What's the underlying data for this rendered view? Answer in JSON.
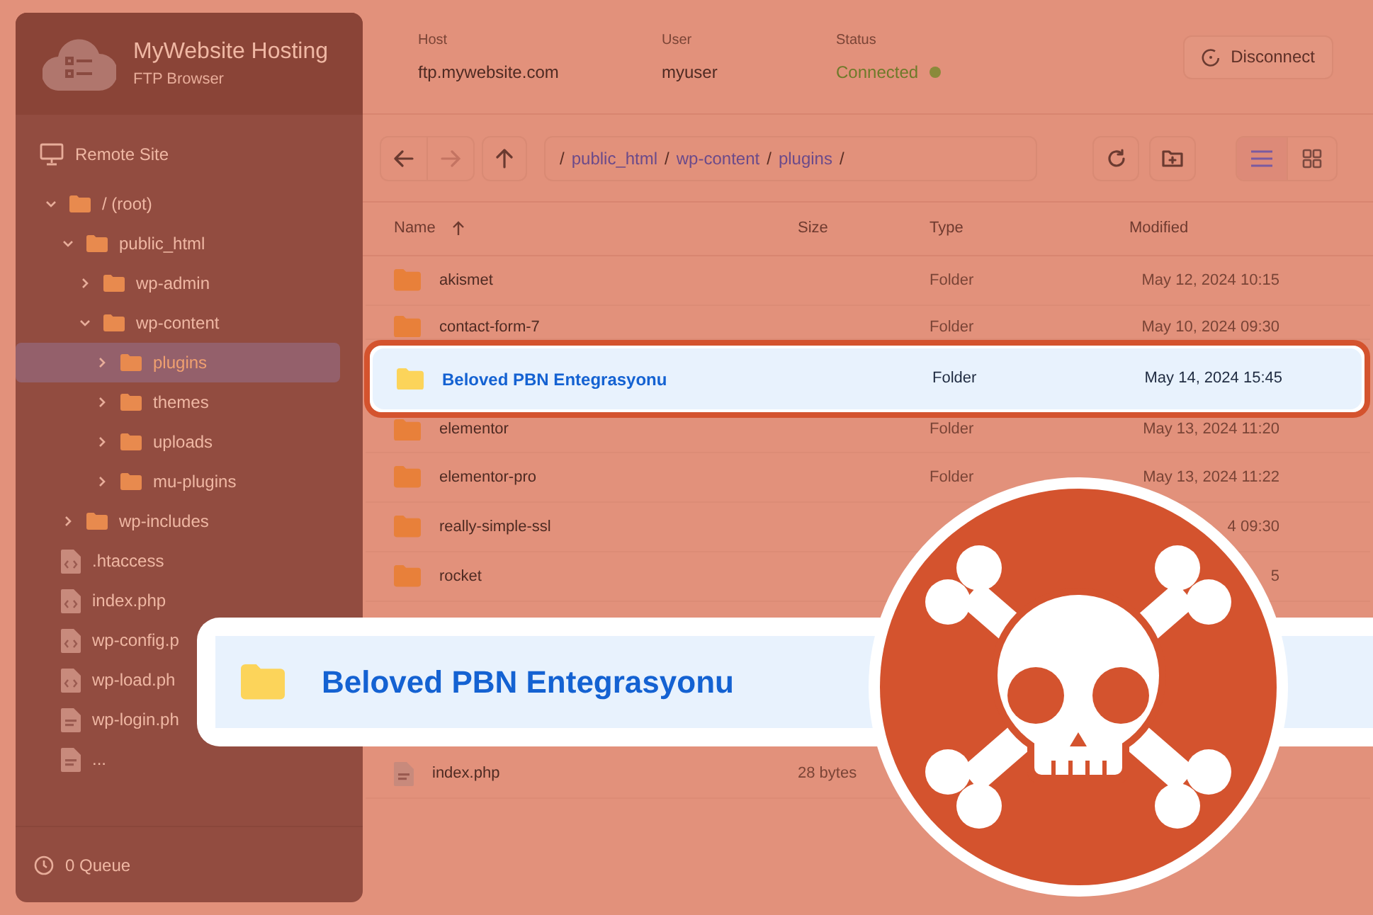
{
  "sidebar": {
    "title": "MyWebsite Hosting",
    "subtitle": "FTP Browser",
    "section": "Remote Site",
    "tree": [
      {
        "name": "/ (root)",
        "kind": "folder",
        "expanded": true,
        "selected": false,
        "children": [
          {
            "name": "public_html",
            "kind": "folder",
            "expanded": true,
            "selected": false,
            "children": [
              {
                "name": "wp-admin",
                "kind": "folder",
                "expanded": false,
                "selected": false
              },
              {
                "name": "wp-content",
                "kind": "folder",
                "expanded": true,
                "selected": false,
                "children": [
                  {
                    "name": "plugins",
                    "kind": "folder",
                    "expanded": false,
                    "selected": true
                  },
                  {
                    "name": "themes",
                    "kind": "folder",
                    "expanded": false,
                    "selected": false
                  },
                  {
                    "name": "uploads",
                    "kind": "folder",
                    "expanded": false,
                    "selected": false
                  },
                  {
                    "name": "mu-plugins",
                    "kind": "folder",
                    "expanded": false,
                    "selected": false
                  }
                ]
              }
            ]
          },
          {
            "name": "wp-includes",
            "kind": "folder",
            "expanded": false,
            "selected": false
          },
          {
            "name": ".htaccess",
            "kind": "code",
            "selected": false
          },
          {
            "name": "index.php",
            "kind": "code",
            "selected": false
          },
          {
            "name": "wp-config.p",
            "kind": "code",
            "selected": false
          },
          {
            "name": "wp-load.ph",
            "kind": "code",
            "selected": false
          },
          {
            "name": "wp-login.ph",
            "kind": "php",
            "selected": false
          },
          {
            "name": "...",
            "kind": "php",
            "selected": false
          }
        ]
      }
    ],
    "queue": "0 Queue"
  },
  "connection": [
    {
      "label": "Host",
      "value": "ftp.mywebsite.com",
      "kind": "text"
    },
    {
      "label": "User",
      "value": "myuser",
      "kind": "text"
    },
    {
      "label": "Status",
      "value": "Connected",
      "kind": "status"
    }
  ],
  "disconnect": "Disconnect",
  "path": [
    {
      "text": "/",
      "kind": "separator"
    },
    {
      "text": "public_html",
      "kind": "link"
    },
    {
      "text": "/",
      "kind": "separator"
    },
    {
      "text": "wp-content",
      "kind": "link"
    },
    {
      "text": "/",
      "kind": "separator"
    },
    {
      "text": "plugins",
      "kind": "link"
    },
    {
      "text": "/",
      "kind": "separator"
    }
  ],
  "views": [
    {
      "kind": "list",
      "selected": true
    },
    {
      "kind": "grid",
      "selected": false
    }
  ],
  "table": {
    "columns": [
      "Name",
      "Size",
      "Type",
      "Modified"
    ],
    "rows": [
      {
        "name": "akismet",
        "kind": "folder",
        "type": "Folder",
        "modified": "May 12, 2024 10:15",
        "selected": false
      },
      {
        "name": "contact-form-7",
        "kind": "folder",
        "type": "Folder",
        "modified": "May 10, 2024 09:30",
        "selected": false
      },
      {
        "name": "Beloved PBN Entegrasyonu",
        "kind": "folder",
        "type": "Folder",
        "modified": "May 14, 2024 15:45",
        "selected": true
      },
      {
        "name": "elementor",
        "kind": "folder",
        "type": "Folder",
        "modified": "May 13, 2024 11:20",
        "selected": false
      },
      {
        "name": "elementor-pro",
        "kind": "folder",
        "type": "Folder",
        "modified": "May 13, 2024 11:22",
        "selected": false
      },
      {
        "name": "really-simple-ssl",
        "kind": "folder",
        "modified": "4 09:30",
        "selected": false
      },
      {
        "name": "rocket",
        "kind": "folder",
        "modified": "5",
        "selected": false
      },
      {
        "name": "index.php",
        "kind": "php",
        "size": "28 bytes",
        "selected": false
      }
    ]
  },
  "banner": {
    "name": "Beloved PBN Entegrasyonu",
    "kind": "folder"
  }
}
